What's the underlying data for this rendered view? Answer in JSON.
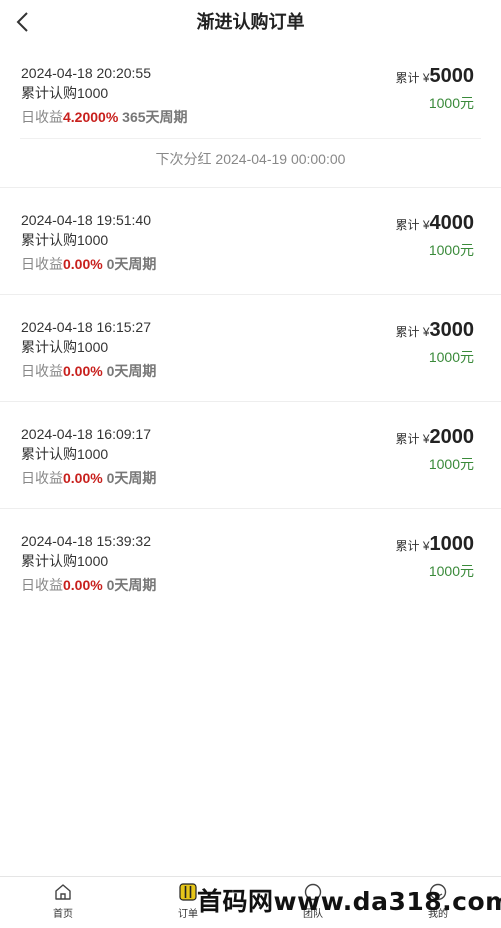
{
  "header": {
    "title": "渐进认购订单"
  },
  "orders": [
    {
      "time": "2024-04-18 20:20:55",
      "subscribed": "累计认购1000",
      "yield_label": "日收益",
      "rate": "4.2000%",
      "days": "365天周期",
      "total_label": "累计 ¥",
      "total_amount": "5000",
      "price": "1000元"
    },
    {
      "time": "2024-04-18 19:51:40",
      "subscribed": "累计认购1000",
      "yield_label": "日收益",
      "rate": "0.00%",
      "days": "0天周期",
      "total_label": "累计 ¥",
      "total_amount": "4000",
      "price": "1000元"
    },
    {
      "time": "2024-04-18 16:15:27",
      "subscribed": "累计认购1000",
      "yield_label": "日收益",
      "rate": "0.00%",
      "days": "0天周期",
      "total_label": "累计 ¥",
      "total_amount": "3000",
      "price": "1000元"
    },
    {
      "time": "2024-04-18 16:09:17",
      "subscribed": "累计认购1000",
      "yield_label": "日收益",
      "rate": "0.00%",
      "days": "0天周期",
      "total_label": "累计 ¥",
      "total_amount": "2000",
      "price": "1000元"
    },
    {
      "time": "2024-04-18 15:39:32",
      "subscribed": "累计认购1000",
      "yield_label": "日收益",
      "rate": "0.00%",
      "days": "0天周期",
      "total_label": "累计 ¥",
      "total_amount": "1000",
      "price": "1000元"
    }
  ],
  "next_dividend": "下次分红 2024-04-19 00:00:00",
  "tabbar": {
    "home": {
      "label": "首页",
      "icon": "home-icon"
    },
    "orders": {
      "label": "订单",
      "icon": "orders-icon",
      "active_color": "#e6c619"
    },
    "team": {
      "label": "团队",
      "icon": "team-icon"
    },
    "mine": {
      "label": "我的",
      "icon": "user-icon"
    }
  },
  "watermark": "首码网www.da318.com"
}
